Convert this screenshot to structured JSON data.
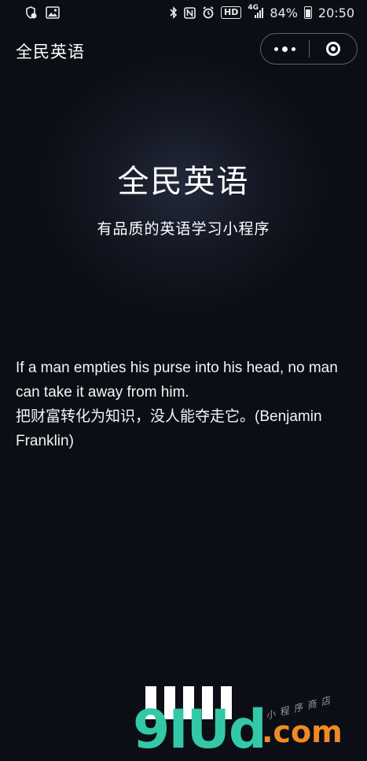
{
  "status_bar": {
    "network": "4G",
    "battery": "84%",
    "time": "20:50",
    "hd_label": "HD",
    "icons": [
      "notification-icon",
      "gallery-icon",
      "bluetooth-icon",
      "nfc-icon",
      "alarm-icon",
      "hd-icon",
      "signal-icon",
      "battery-icon"
    ]
  },
  "navbar": {
    "title": "全民英语",
    "capsule_icons": [
      "more-icon",
      "close-miniprogram-icon"
    ]
  },
  "hero": {
    "title": "全民英语",
    "subtitle": "有品质的英语学习小程序"
  },
  "quote": {
    "english": "If a man empties his purse into his head, no man can take it away from him.",
    "chinese": "把财富转化为知识，没人能夺走它。(Benjamin Franklin)"
  },
  "watermark": {
    "logo": "9IUd",
    "domain": ".com",
    "tagline": "小程序商店"
  },
  "colors": {
    "background": "#0c0e15",
    "text": "#ffffff",
    "watermark_green": "#33c8a8",
    "watermark_orange": "#f08a24"
  }
}
